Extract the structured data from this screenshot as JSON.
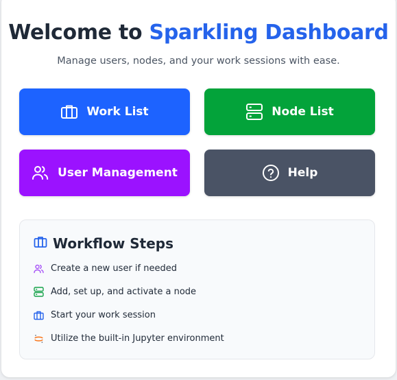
{
  "header": {
    "title_prefix": "Welcome to",
    "title_brand": "Sparkling Dashboard",
    "subtitle": "Manage users, nodes, and your work sessions with ease."
  },
  "actions": {
    "work_list": "Work List",
    "node_list": "Node List",
    "user_management": "User Management",
    "help": "Help"
  },
  "workflow": {
    "title": "Workflow Steps",
    "steps": [
      "Create a new user if needed",
      "Add, set up, and activate a node",
      "Start your work session",
      "Utilize the built-in Jupyter environment"
    ]
  },
  "colors": {
    "brand": "#2563eb",
    "work_list": "#1d63ff",
    "node_list": "#03a33a",
    "user_management": "#9b12ff",
    "help": "#4a5365"
  },
  "icons": {
    "work_list": "briefcase-icon",
    "node_list": "server-icon",
    "user_management": "users-icon",
    "help": "question-circle-icon",
    "steps": [
      "users-icon",
      "server-icon",
      "briefcase-icon",
      "jupyter-icon"
    ]
  }
}
